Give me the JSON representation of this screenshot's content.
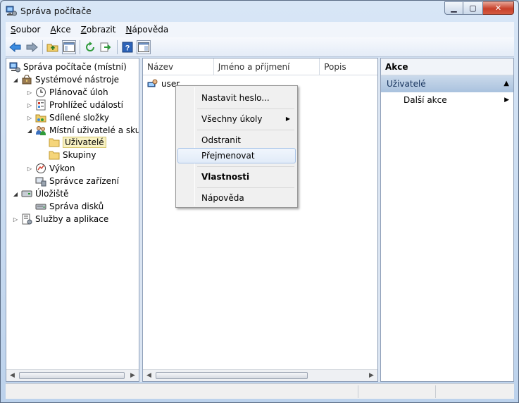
{
  "window": {
    "title": "Správa počítače"
  },
  "menu": [
    {
      "label_ul": "S",
      "label_rest": "oubor"
    },
    {
      "label_ul": "A",
      "label_rest": "kce"
    },
    {
      "label_ul": "Z",
      "label_rest": "obrazit"
    },
    {
      "label_ul": "N",
      "label_rest": "ápověda"
    }
  ],
  "tree": {
    "root": "Správa počítače (místní)",
    "system_tools": "Systémové nástroje",
    "task_scheduler": "Plánovač úloh",
    "event_viewer": "Prohlížeč událostí",
    "shared_folders": "Sdílené složky",
    "local_users": "Místní uživatelé a skupiny",
    "users": "Uživatelé",
    "groups": "Skupiny",
    "performance": "Výkon",
    "device_manager": "Správce zařízení",
    "storage": "Úložiště",
    "disk_management": "Správa disků",
    "services": "Služby a aplikace"
  },
  "list": {
    "columns": [
      "Název",
      "Jméno a příjmení",
      "Popis"
    ],
    "items": [
      "user"
    ]
  },
  "actions": {
    "header": "Akce",
    "section": "Uživatelé",
    "more": "Další akce"
  },
  "context_menu": {
    "set_password": "Nastavit heslo...",
    "all_tasks": "Všechny úkoly",
    "delete": "Odstranit",
    "rename": "Přejmenovat",
    "properties": "Vlastnosti",
    "help": "Nápověda"
  }
}
